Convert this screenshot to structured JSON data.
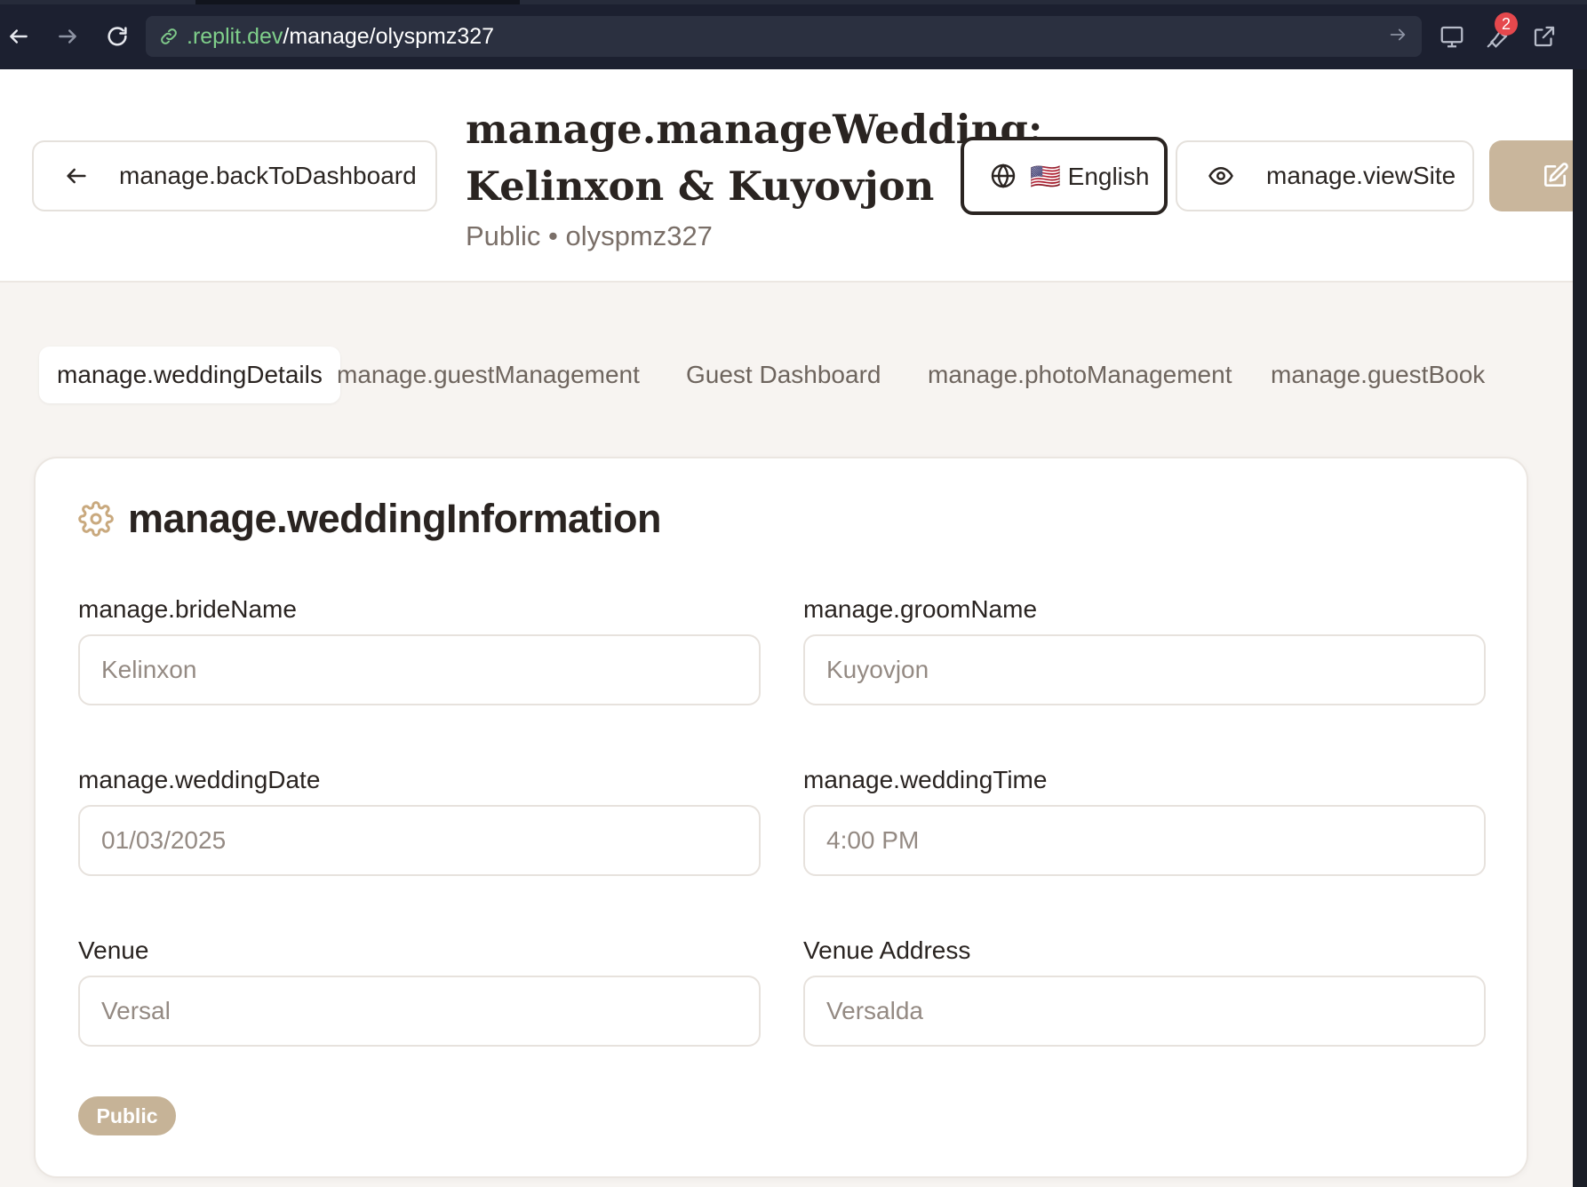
{
  "browser": {
    "url_host": ".replit.dev",
    "url_path": "/manage/olyspmz327",
    "extensions_badge": "2"
  },
  "header": {
    "back_label": "manage.backToDashboard",
    "title": "manage.manageWedding: Kelinxon & Kuyovjon",
    "subtitle": "Public • olyspmz327",
    "language_label": "🇺🇸 English",
    "view_site_label": "manage.viewSite"
  },
  "tabs": [
    {
      "label": "manage.weddingDetails",
      "active": true
    },
    {
      "label": "manage.guestManagement"
    },
    {
      "label": "Guest Dashboard"
    },
    {
      "label": "manage.photoManagement"
    },
    {
      "label": "manage.guestBook"
    }
  ],
  "card": {
    "title": "manage.weddingInformation",
    "fields": {
      "bride": {
        "label": "manage.brideName",
        "value": "Kelinxon"
      },
      "groom": {
        "label": "manage.groomName",
        "value": "Kuyovjon"
      },
      "date": {
        "label": "manage.weddingDate",
        "value": "01/03/2025"
      },
      "time": {
        "label": "manage.weddingTime",
        "value": "4:00 PM"
      },
      "venue": {
        "label": "Venue",
        "value": "Versal"
      },
      "address": {
        "label": "Venue Address",
        "value": "Versalda"
      }
    },
    "status_badge": "Public"
  },
  "colors": {
    "accent": "#c9b69c",
    "page_bg": "#f7f4f1",
    "text_dark": "#2a2421"
  }
}
